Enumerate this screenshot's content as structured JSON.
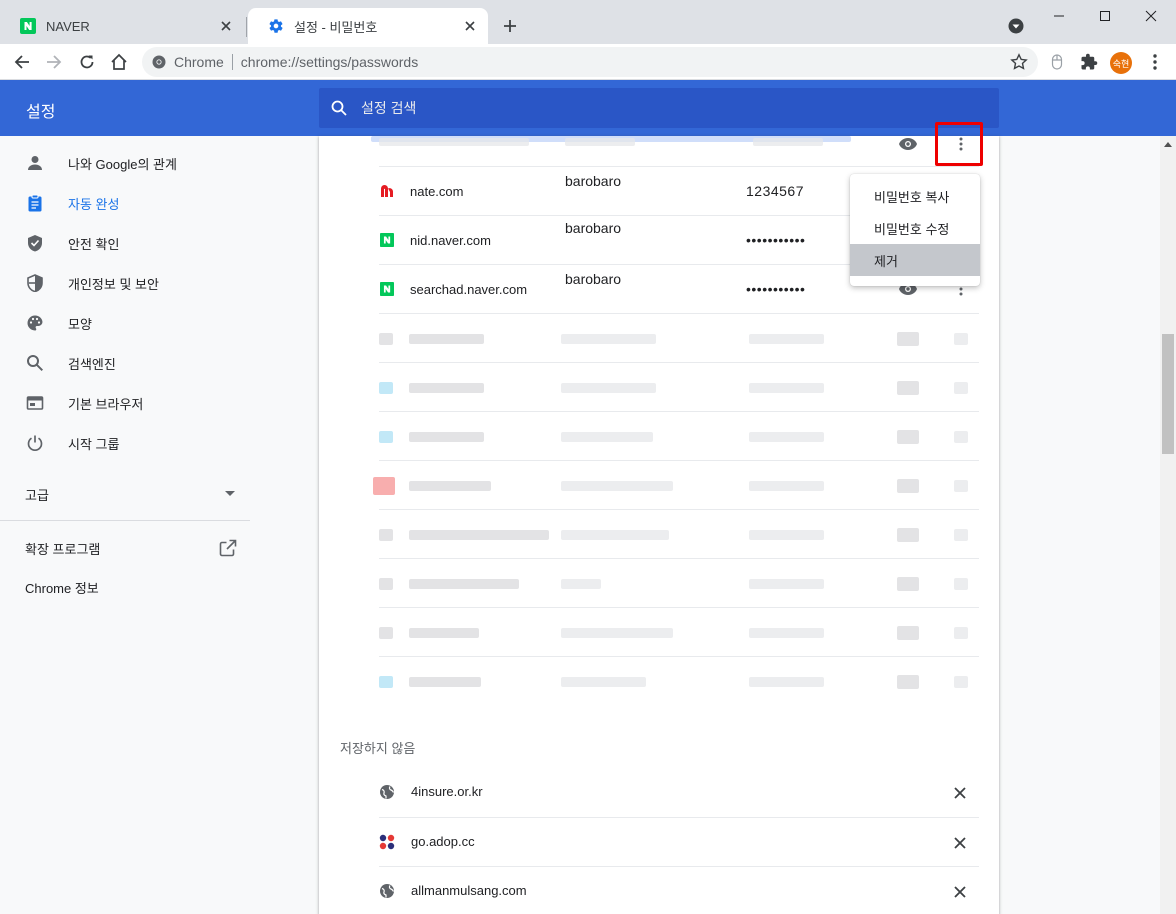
{
  "tabs": [
    {
      "title": "NAVER",
      "favicon": "naver-icon"
    },
    {
      "title": "설정 - 비밀번호",
      "favicon": "settings-gear-icon"
    }
  ],
  "toolbar": {
    "site_label": "Chrome",
    "url": "chrome://settings/passwords",
    "profile_initials": "숙현"
  },
  "header": {
    "title": "설정",
    "search_placeholder": "설정 검색"
  },
  "sidebar": {
    "items": [
      {
        "label": "나와 Google의 관계",
        "icon": "person-icon"
      },
      {
        "label": "자동 완성",
        "icon": "clipboard-icon",
        "selected": true
      },
      {
        "label": "안전 확인",
        "icon": "shield-check-icon"
      },
      {
        "label": "개인정보 및 보안",
        "icon": "shield-half-icon"
      },
      {
        "label": "모양",
        "icon": "palette-icon"
      },
      {
        "label": "검색엔진",
        "icon": "search-icon"
      },
      {
        "label": "기본 브라우저",
        "icon": "browser-icon"
      },
      {
        "label": "시작 그룹",
        "icon": "power-icon"
      }
    ],
    "advanced": "고급",
    "extensions": "확장 프로그램",
    "about": "Chrome 정보"
  },
  "passwords": [
    {
      "site": "nate.com",
      "username": "barobaro",
      "password": "1234567",
      "favicon": "nate-icon"
    },
    {
      "site": "nid.naver.com",
      "username": "barobaro",
      "password": "•••••••••••",
      "favicon": "naver-icon"
    },
    {
      "site": "searchad.naver.com",
      "username": "barobaro",
      "password": "•••••••••••",
      "favicon": "naver-icon"
    }
  ],
  "context_menu": {
    "items": [
      "비밀번호 복사",
      "비밀번호 수정",
      "제거"
    ]
  },
  "never_saved": {
    "label": "저장하지 않음",
    "sites": [
      {
        "site": "4insure.or.kr",
        "favicon": "globe-icon"
      },
      {
        "site": "go.adop.cc",
        "favicon": "adop-icon"
      },
      {
        "site": "allmanmulsang.com",
        "favicon": "globe-icon"
      }
    ]
  },
  "colors": {
    "header_blue": "#3367d6",
    "accent_blue": "#1a73e8",
    "naver_green": "#03c75a",
    "nate_red": "#e51c23",
    "highlight_red": "#ee0000"
  }
}
